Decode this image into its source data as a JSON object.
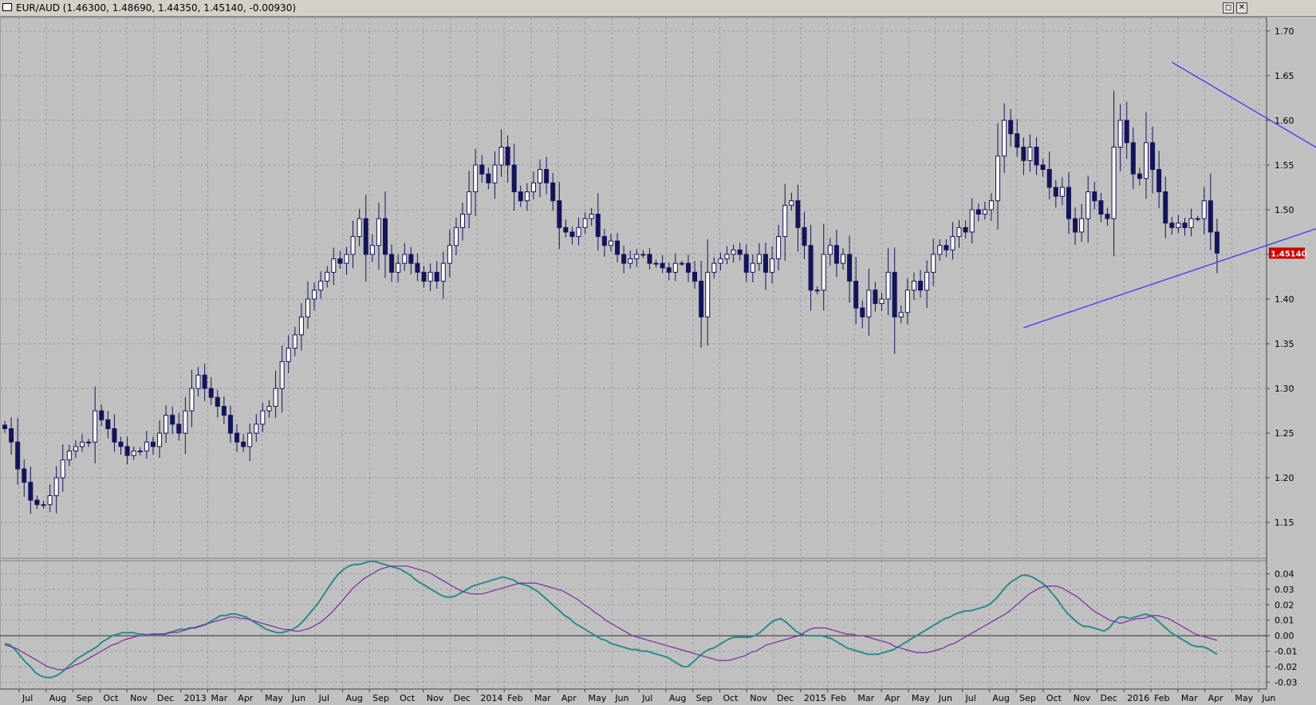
{
  "window": {
    "title": "EUR/AUD (1.46300, 1.48690, 1.44350, 1.45140, -0.00930)",
    "restore_symbol": "◻",
    "close_symbol": "✕"
  },
  "colors": {
    "background": "#c0c0c0",
    "grid": "#9a9aa6",
    "candle": "#14145a",
    "trendline": "#3a3aff",
    "oscillator_fast": "#2a8a8a",
    "oscillator_slow": "#7a2aa0",
    "price_tag_bg": "#cc0000",
    "price_tag_fg": "#ffffff"
  },
  "chart_data": [
    {
      "type": "candlestick",
      "title": "EUR/AUD",
      "period": "weekly",
      "ohlc_summary": {
        "open": 1.463,
        "high": 1.4869,
        "low": 1.4435,
        "close": 1.4514,
        "change": -0.0093
      },
      "last_price_label": "1.45140",
      "y_ticks": [
        "1.70",
        "1.65",
        "1.60",
        "1.55",
        "1.50",
        "1.45",
        "1.40",
        "1.35",
        "1.30",
        "1.25",
        "1.20",
        "1.15"
      ],
      "ylim": [
        1.11,
        1.715
      ],
      "x_labels": [
        "Jul",
        "Aug",
        "Sep",
        "Oct",
        "Nov",
        "Dec",
        "2013",
        "Mar",
        "Apr",
        "May",
        "Jun",
        "Jul",
        "Aug",
        "Sep",
        "Oct",
        "Nov",
        "Dec",
        "2014",
        "Feb",
        "Mar",
        "Apr",
        "May",
        "Jun",
        "Jul",
        "Aug",
        "Sep",
        "Oct",
        "Nov",
        "Dec",
        "2015",
        "Feb",
        "Mar",
        "Apr",
        "May",
        "Jun",
        "Jul",
        "Aug",
        "Sep",
        "Oct",
        "Nov",
        "Dec",
        "2016",
        "Feb",
        "Mar",
        "Apr",
        "May",
        "Jun"
      ],
      "closes": [
        1.255,
        1.24,
        1.21,
        1.195,
        1.175,
        1.17,
        1.17,
        1.18,
        1.2,
        1.22,
        1.23,
        1.235,
        1.24,
        1.24,
        1.275,
        1.265,
        1.255,
        1.24,
        1.235,
        1.225,
        1.23,
        1.23,
        1.24,
        1.235,
        1.25,
        1.27,
        1.26,
        1.25,
        1.275,
        1.3,
        1.315,
        1.3,
        1.29,
        1.28,
        1.27,
        1.25,
        1.24,
        1.235,
        1.25,
        1.26,
        1.275,
        1.28,
        1.3,
        1.33,
        1.345,
        1.36,
        1.38,
        1.4,
        1.41,
        1.42,
        1.43,
        1.445,
        1.44,
        1.45,
        1.47,
        1.49,
        1.45,
        1.46,
        1.49,
        1.45,
        1.43,
        1.44,
        1.45,
        1.44,
        1.43,
        1.42,
        1.43,
        1.42,
        1.44,
        1.46,
        1.48,
        1.495,
        1.52,
        1.55,
        1.54,
        1.53,
        1.55,
        1.57,
        1.55,
        1.52,
        1.51,
        1.52,
        1.53,
        1.545,
        1.53,
        1.51,
        1.48,
        1.475,
        1.47,
        1.48,
        1.49,
        1.495,
        1.47,
        1.46,
        1.465,
        1.45,
        1.44,
        1.445,
        1.45,
        1.45,
        1.44,
        1.44,
        1.435,
        1.43,
        1.44,
        1.44,
        1.43,
        1.42,
        1.38,
        1.43,
        1.44,
        1.445,
        1.45,
        1.455,
        1.45,
        1.43,
        1.44,
        1.45,
        1.43,
        1.445,
        1.47,
        1.505,
        1.51,
        1.48,
        1.46,
        1.41,
        1.41,
        1.45,
        1.46,
        1.44,
        1.45,
        1.42,
        1.39,
        1.38,
        1.41,
        1.395,
        1.4,
        1.43,
        1.38,
        1.385,
        1.41,
        1.42,
        1.41,
        1.43,
        1.45,
        1.46,
        1.455,
        1.47,
        1.48,
        1.475,
        1.5,
        1.495,
        1.5,
        1.51,
        1.56,
        1.6,
        1.585,
        1.57,
        1.555,
        1.57,
        1.55,
        1.545,
        1.525,
        1.515,
        1.525,
        1.49,
        1.475,
        1.49,
        1.52,
        1.51,
        1.495,
        1.49,
        1.57,
        1.6,
        1.575,
        1.54,
        1.535,
        1.575,
        1.545,
        1.52,
        1.485,
        1.48,
        1.485,
        1.48,
        1.49,
        1.49,
        1.51,
        1.475,
        1.4514
      ],
      "trendlines": [
        {
          "from": [
            181,
            1.665
          ],
          "to": [
            208,
            1.55
          ]
        },
        {
          "from": [
            158,
            1.368
          ],
          "to": [
            208,
            1.49
          ]
        }
      ]
    },
    {
      "type": "line",
      "title": "",
      "y_ticks": [
        "0.04",
        "0.03",
        "0.02",
        "0.01",
        "0.00",
        "-0.01",
        "-0.02",
        "-0.03"
      ],
      "ylim": [
        -0.0345,
        0.0485
      ],
      "zero_line": 0.0,
      "series": [
        {
          "color": "#2a8a8a",
          "values": [
            -0.005,
            -0.006,
            -0.009,
            -0.013,
            -0.017,
            -0.02,
            -0.024,
            -0.026,
            -0.027,
            -0.027,
            -0.026,
            -0.024,
            -0.021,
            -0.018,
            -0.015,
            -0.013,
            -0.011,
            -0.009,
            -0.007,
            -0.004,
            -0.002,
            0.0,
            0.001,
            0.002,
            0.002,
            0.002,
            0.001,
            0.001,
            0.0,
            0.001,
            0.001,
            0.001,
            0.002,
            0.003,
            0.004,
            0.004,
            0.005,
            0.005,
            0.006,
            0.007,
            0.009,
            0.011,
            0.013,
            0.013,
            0.014,
            0.014,
            0.013,
            0.012,
            0.01,
            0.008,
            0.006,
            0.004,
            0.003,
            0.002,
            0.002,
            0.003,
            0.004,
            0.006,
            0.009,
            0.013,
            0.017,
            0.021,
            0.026,
            0.031,
            0.036,
            0.04,
            0.043,
            0.045,
            0.046,
            0.046,
            0.047,
            0.048,
            0.048,
            0.047,
            0.046,
            0.045,
            0.044,
            0.043,
            0.041,
            0.039,
            0.036,
            0.034,
            0.032,
            0.03,
            0.028,
            0.026,
            0.025,
            0.025,
            0.026,
            0.028,
            0.03,
            0.032,
            0.033,
            0.034,
            0.035,
            0.036,
            0.037,
            0.038,
            0.037,
            0.036,
            0.034,
            0.033,
            0.032,
            0.03,
            0.028,
            0.025,
            0.022,
            0.019,
            0.016,
            0.013,
            0.011,
            0.008,
            0.006,
            0.004,
            0.002,
            0.0,
            -0.002,
            -0.003,
            -0.005,
            -0.006,
            -0.007,
            -0.008,
            -0.009,
            -0.009,
            -0.01,
            -0.01,
            -0.011,
            -0.012,
            -0.013,
            -0.014,
            -0.016,
            -0.018,
            -0.02,
            -0.02,
            -0.017,
            -0.014,
            -0.011,
            -0.009,
            -0.008,
            -0.006,
            -0.004,
            -0.002,
            -0.001,
            -0.001,
            -0.001,
            -0.001,
            0.0,
            0.002,
            0.005,
            0.008,
            0.01,
            0.011,
            0.009,
            0.006,
            0.003,
            0.001,
            0.0,
            0.0,
            0.0,
            0.0,
            -0.001,
            -0.002,
            -0.004,
            -0.006,
            -0.008,
            -0.009,
            -0.01,
            -0.011,
            -0.012,
            -0.012,
            -0.012,
            -0.011,
            -0.01,
            -0.009,
            -0.007,
            -0.005,
            -0.003,
            -0.001,
            0.001,
            0.003,
            0.005,
            0.007,
            0.009,
            0.011,
            0.012,
            0.014,
            0.015,
            0.016,
            0.016,
            0.017,
            0.018,
            0.019,
            0.021,
            0.024,
            0.028,
            0.032,
            0.035,
            0.037,
            0.039,
            0.039,
            0.038,
            0.036,
            0.034,
            0.031,
            0.027,
            0.023,
            0.018,
            0.014,
            0.011,
            0.008,
            0.006,
            0.006,
            0.005,
            0.004,
            0.003,
            0.005,
            0.009,
            0.012,
            0.012,
            0.011,
            0.012,
            0.013,
            0.014,
            0.013,
            0.011,
            0.008,
            0.005,
            0.002,
            0.0,
            -0.002,
            -0.004,
            -0.006,
            -0.007,
            -0.007,
            -0.008,
            -0.01,
            -0.012
          ]
        },
        {
          "color": "#7a2aa0",
          "values": [
            -0.006,
            -0.007,
            -0.008,
            -0.01,
            -0.012,
            -0.014,
            -0.016,
            -0.018,
            -0.02,
            -0.021,
            -0.022,
            -0.022,
            -0.021,
            -0.019,
            -0.018,
            -0.016,
            -0.014,
            -0.012,
            -0.01,
            -0.008,
            -0.006,
            -0.005,
            -0.003,
            -0.002,
            -0.001,
            0.0,
            0.0,
            0.001,
            0.001,
            0.001,
            0.001,
            0.002,
            0.002,
            0.003,
            0.004,
            0.005,
            0.006,
            0.007,
            0.008,
            0.009,
            0.01,
            0.011,
            0.012,
            0.012,
            0.011,
            0.011,
            0.01,
            0.009,
            0.008,
            0.007,
            0.006,
            0.005,
            0.004,
            0.004,
            0.003,
            0.003,
            0.004,
            0.005,
            0.007,
            0.009,
            0.012,
            0.015,
            0.019,
            0.023,
            0.027,
            0.031,
            0.034,
            0.037,
            0.039,
            0.041,
            0.043,
            0.044,
            0.045,
            0.045,
            0.045,
            0.045,
            0.044,
            0.043,
            0.042,
            0.041,
            0.039,
            0.037,
            0.035,
            0.033,
            0.031,
            0.029,
            0.028,
            0.027,
            0.027,
            0.027,
            0.028,
            0.029,
            0.03,
            0.031,
            0.032,
            0.033,
            0.034,
            0.034,
            0.034,
            0.034,
            0.033,
            0.032,
            0.031,
            0.03,
            0.029,
            0.027,
            0.025,
            0.023,
            0.02,
            0.018,
            0.015,
            0.013,
            0.01,
            0.008,
            0.006,
            0.004,
            0.002,
            0.0,
            -0.001,
            -0.002,
            -0.003,
            -0.004,
            -0.005,
            -0.006,
            -0.007,
            -0.008,
            -0.009,
            -0.01,
            -0.011,
            -0.012,
            -0.013,
            -0.014,
            -0.015,
            -0.016,
            -0.016,
            -0.016,
            -0.015,
            -0.014,
            -0.013,
            -0.011,
            -0.01,
            -0.008,
            -0.006,
            -0.005,
            -0.004,
            -0.003,
            -0.002,
            -0.001,
            0.0,
            0.002,
            0.004,
            0.005,
            0.005,
            0.005,
            0.004,
            0.003,
            0.002,
            0.001,
            0.001,
            0.0,
            0.0,
            -0.001,
            -0.002,
            -0.003,
            -0.004,
            -0.005,
            -0.007,
            -0.008,
            -0.009,
            -0.01,
            -0.011,
            -0.011,
            -0.011,
            -0.01,
            -0.009,
            -0.008,
            -0.006,
            -0.005,
            -0.003,
            -0.001,
            0.001,
            0.003,
            0.005,
            0.007,
            0.009,
            0.011,
            0.013,
            0.015,
            0.018,
            0.021,
            0.024,
            0.027,
            0.029,
            0.031,
            0.032,
            0.032,
            0.032,
            0.031,
            0.029,
            0.027,
            0.025,
            0.022,
            0.019,
            0.016,
            0.014,
            0.012,
            0.01,
            0.009,
            0.008,
            0.009,
            0.01,
            0.011,
            0.011,
            0.012,
            0.013,
            0.013,
            0.012,
            0.011,
            0.009,
            0.007,
            0.005,
            0.003,
            0.001,
            0.0,
            -0.001,
            -0.002,
            -0.003
          ]
        }
      ]
    }
  ]
}
